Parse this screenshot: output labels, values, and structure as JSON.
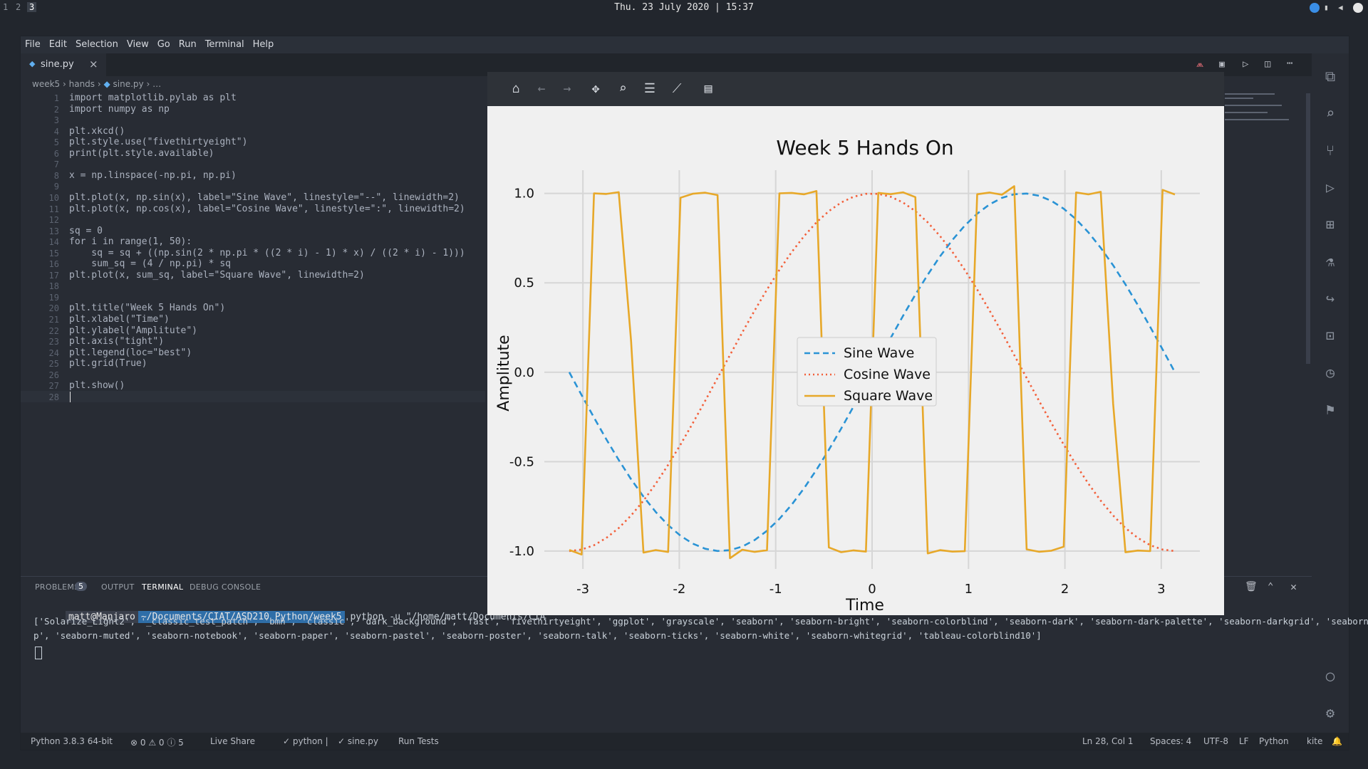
{
  "topbar": {
    "workspaces": [
      "1",
      "2",
      "3"
    ],
    "clock": "Thu. 23 July 2020  |  15:37"
  },
  "menu": [
    "File",
    "Edit",
    "Selection",
    "View",
    "Go",
    "Run",
    "Terminal",
    "Help"
  ],
  "tab": {
    "label": "sine.py",
    "close": "×"
  },
  "breadcrumb": {
    "a": "week5",
    "b": "hands",
    "c": "sine.py",
    "d": "…"
  },
  "code_lines": [
    "import matplotlib.pylab as plt",
    "import numpy as np",
    "",
    "plt.xkcd()",
    "plt.style.use(\"fivethirtyeight\")",
    "print(plt.style.available)",
    "",
    "x = np.linspace(-np.pi, np.pi)",
    "",
    "plt.plot(x, np.sin(x), label=\"Sine Wave\", linestyle=\"--\", linewidth=2)",
    "plt.plot(x, np.cos(x), label=\"Cosine Wave\", linestyle=\":\", linewidth=2)",
    "",
    "sq = 0",
    "for i in range(1, 50):",
    "    sq = sq + ((np.sin(2 * np.pi * ((2 * i) - 1) * x) / ((2 * i) - 1)))",
    "    sum_sq = (4 / np.pi) * sq",
    "plt.plot(x, sum_sq, label=\"Square Wave\", linewidth=2)",
    "",
    "",
    "plt.title(\"Week 5 Hands On\")",
    "plt.xlabel(\"Time\")",
    "plt.ylabel(\"Amplitute\")",
    "plt.axis(\"tight\")",
    "plt.legend(loc=\"best\")",
    "plt.grid(True)",
    "",
    "plt.show()",
    ""
  ],
  "panel": {
    "tabs": [
      "PROBLEMS",
      "OUTPUT",
      "TERMINAL",
      "DEBUG CONSOLE"
    ],
    "problems_count": "5",
    "prompt_user": "matt@Manjaro",
    "prompt_path": "~/Documents/CIAT/ASD210 Python/week5",
    "command": "python -u \"/home/matt/Documents/CIA",
    "output_line1": "['Solarize_Light2', '_classic_test_patch', 'bmh', 'classic', 'dark_background', 'fast', 'fivethirtyeight', 'ggplot', 'grayscale', 'seaborn', 'seaborn-bright', 'seaborn-colorblind', 'seaborn-dark', 'seaborn-dark-palette', 'seaborn-darkgrid', 'seaborn-dee",
    "output_line2": "p', 'seaborn-muted', 'seaborn-notebook', 'seaborn-paper', 'seaborn-pastel', 'seaborn-poster', 'seaborn-talk', 'seaborn-ticks', 'seaborn-white', 'seaborn-whitegrid', 'tableau-colorblind10']"
  },
  "status": {
    "python": "Python 3.8.3 64-bit",
    "problems": "⊗ 0 ⚠ 0 ⓘ 5",
    "liveshare": "Live Share",
    "lint": "✓ python |",
    "file": "✓ sine.py",
    "tests": "Run Tests",
    "position": "Ln 28, Col 1",
    "spaces": "Spaces: 4",
    "encoding": "UTF-8",
    "eol": "LF",
    "lang": "Python",
    "kite": "kite"
  },
  "colors": {
    "sine": "#2a93d5",
    "cosine": "#f3603b",
    "square": "#e7a829",
    "accent": "#007acc"
  },
  "chart_data": {
    "type": "line",
    "title": "Week 5 Hands On",
    "xlabel": "Time",
    "ylabel": "Amplitute",
    "xlim": [
      -3.4,
      3.4
    ],
    "ylim": [
      -1.1,
      1.13
    ],
    "xticks": [
      "-3",
      "-2",
      "-1",
      "0",
      "1",
      "2",
      "3"
    ],
    "yticks": [
      "1.0",
      "0.5",
      "0.0",
      "-0.5",
      "-1.0"
    ],
    "grid": true,
    "legend": "center",
    "series": [
      {
        "name": "Sine Wave",
        "function": "sin",
        "linestyle": "dashed"
      },
      {
        "name": "Cosine Wave",
        "function": "cos",
        "linestyle": "dotted"
      },
      {
        "name": "Square Wave",
        "function": "square",
        "linestyle": "solid"
      }
    ]
  }
}
